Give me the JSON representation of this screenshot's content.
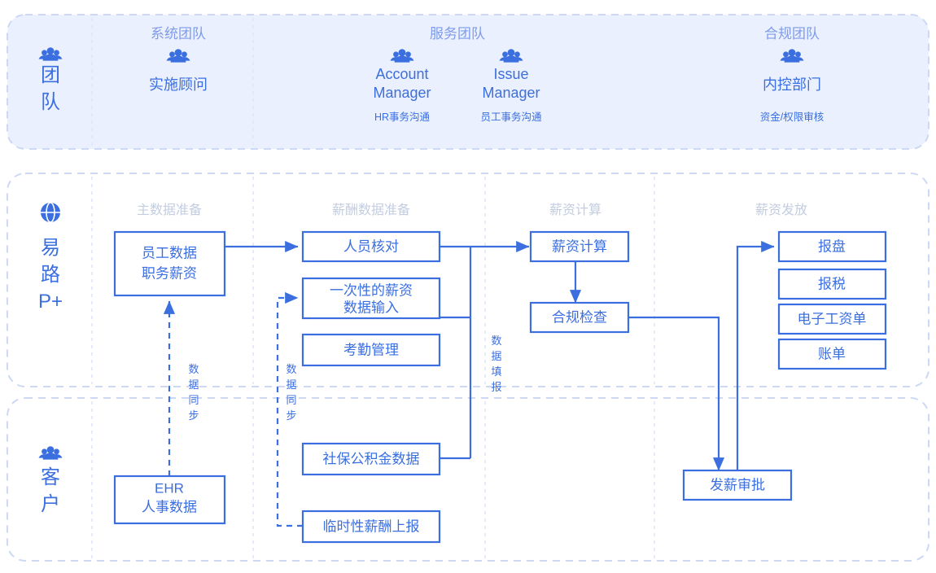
{
  "theme": {
    "accent": "#3b6fe0",
    "band_team_fill": "#eaf0fe",
    "band_border": "#ccd8f5",
    "stage_label_color": "#c3cde0",
    "muted_heading": "#7f9bea"
  },
  "lanes": [
    {
      "id": "team",
      "label": "团队",
      "icon": "people-icon"
    },
    {
      "id": "yilu",
      "label": "易路\nP+",
      "icon": "globe-icon",
      "line1": "易",
      "line2": "路",
      "line3": "P+"
    },
    {
      "id": "customer",
      "label": "客户",
      "icon": "people-icon"
    }
  ],
  "team_band": {
    "lane_label_line1": "团",
    "lane_label_line2": "队",
    "groups": [
      {
        "heading": "系统团队",
        "icon": "people-icon",
        "role": "实施顾问",
        "sub": ""
      },
      {
        "heading": "服务团队",
        "icon": "people-icon",
        "role": "Account\nManager",
        "role_line1": "Account",
        "role_line2": "Manager",
        "sub": "HR事务沟通"
      },
      {
        "heading": "",
        "icon": "people-icon",
        "role": "Issue\nManager",
        "role_line1": "Issue",
        "role_line2": "Manager",
        "sub": "员工事务沟通"
      },
      {
        "heading": "合规团队",
        "icon": "people-icon",
        "role": "内控部门",
        "sub": "资金/权限审核"
      }
    ]
  },
  "yilu_band": {
    "lane_label_line1": "易",
    "lane_label_line2": "路",
    "lane_label_line3": "P+"
  },
  "customer_band": {
    "lane_label_line1": "客",
    "lane_label_line2": "户"
  },
  "stages": [
    {
      "id": "master-data",
      "label": "主数据准备"
    },
    {
      "id": "payroll-data",
      "label": "薪酬数据准备"
    },
    {
      "id": "payroll-calc",
      "label": "薪资计算"
    },
    {
      "id": "payroll-issue",
      "label": "薪资发放"
    }
  ],
  "nodes": [
    {
      "id": "employee-data",
      "lines": [
        "员工数据",
        "职务薪资"
      ]
    },
    {
      "id": "staff-check",
      "lines": [
        "人员核对"
      ]
    },
    {
      "id": "onetime-pay",
      "lines": [
        "一次性的薪资",
        "数据输入"
      ]
    },
    {
      "id": "attendance",
      "lines": [
        "考勤管理"
      ]
    },
    {
      "id": "payroll-calc",
      "lines": [
        "薪资计算"
      ]
    },
    {
      "id": "compliance",
      "lines": [
        "合规检查"
      ]
    },
    {
      "id": "bank-file",
      "lines": [
        "报盘"
      ]
    },
    {
      "id": "tax-filing",
      "lines": [
        "报税"
      ]
    },
    {
      "id": "e-payslip",
      "lines": [
        "电子工资单"
      ]
    },
    {
      "id": "billing",
      "lines": [
        "账单"
      ]
    },
    {
      "id": "ehr",
      "lines": [
        "EHR",
        "人事数据"
      ]
    },
    {
      "id": "social-fund",
      "lines": [
        "社保公积金数据"
      ]
    },
    {
      "id": "temp-pay-report",
      "lines": [
        "临时性薪酬上报"
      ]
    },
    {
      "id": "pay-approval",
      "lines": [
        "发薪审批"
      ]
    }
  ],
  "edge_labels": [
    {
      "id": "sync-left",
      "chars": [
        "数",
        "据",
        "同",
        "步"
      ]
    },
    {
      "id": "sync-mid",
      "chars": [
        "数",
        "据",
        "同",
        "步"
      ]
    },
    {
      "id": "data-fill",
      "chars": [
        "数",
        "据",
        "填",
        "报"
      ]
    }
  ]
}
